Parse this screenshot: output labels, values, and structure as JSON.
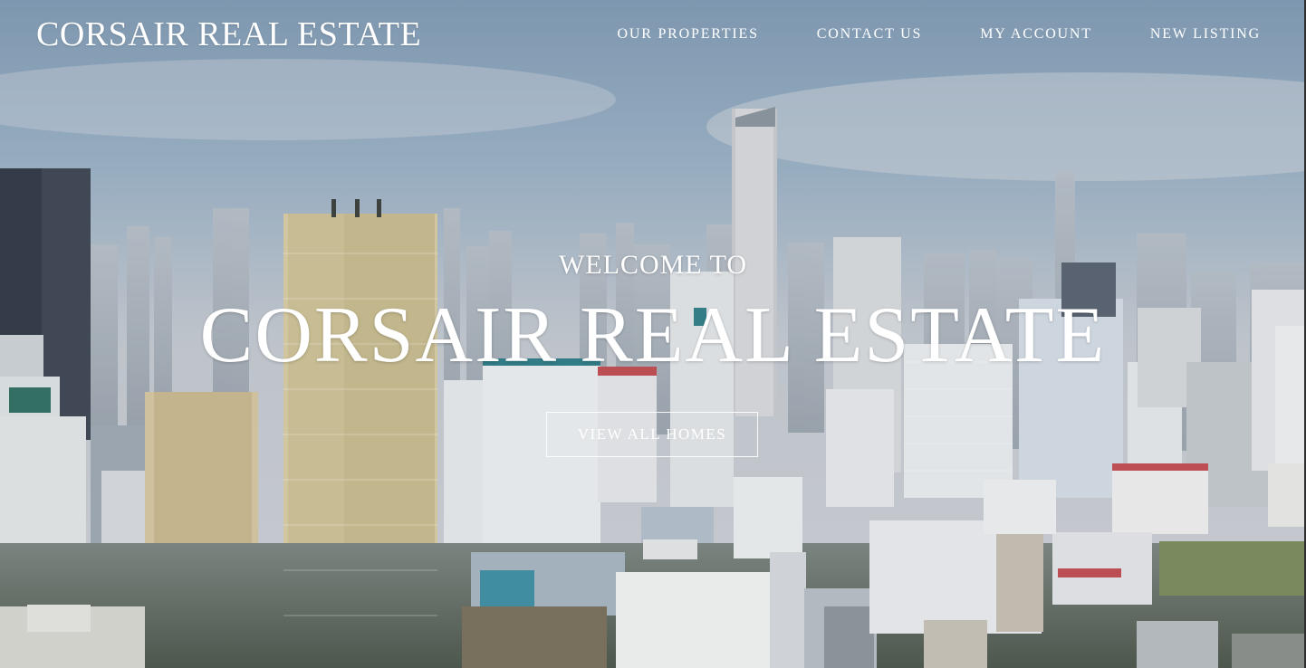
{
  "header": {
    "brand": "CORSAIR REAL ESTATE",
    "nav": [
      {
        "label": "OUR PROPERTIES"
      },
      {
        "label": "CONTACT US"
      },
      {
        "label": "MY ACCOUNT"
      },
      {
        "label": "NEW LISTING"
      }
    ]
  },
  "hero": {
    "welcome": "WELCOME TO",
    "title": "CORSAIR REAL ESTATE",
    "cta_label": "VIEW ALL HOMES",
    "background": "aerial-city-skyline-photo"
  },
  "colors": {
    "text": "#ffffff",
    "sky_top": "#8fa9c2",
    "sky_bottom": "#c9cfd6"
  }
}
